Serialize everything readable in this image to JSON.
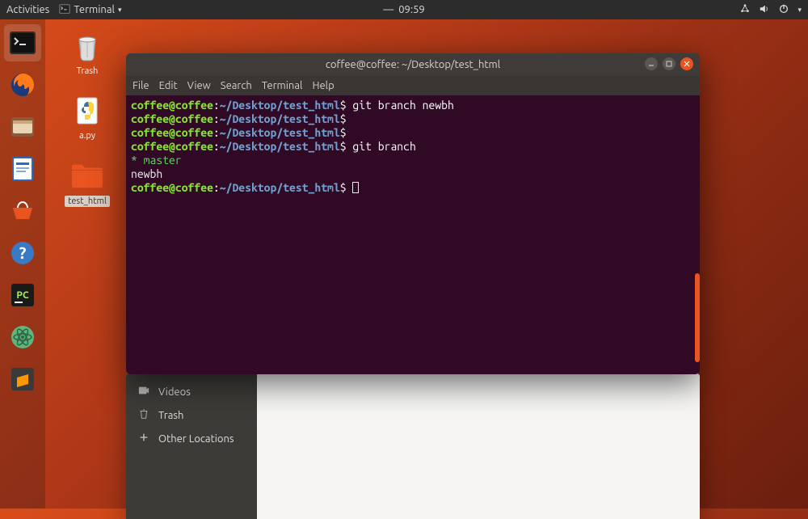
{
  "topbar": {
    "activities": "Activities",
    "app_label": "Terminal",
    "time": "09:59"
  },
  "desktop": {
    "icons": [
      {
        "label": "Trash"
      },
      {
        "label": "a.py"
      },
      {
        "label": "test_html"
      }
    ]
  },
  "files": {
    "items": [
      {
        "icon": "video-icon",
        "label": "Videos"
      },
      {
        "icon": "trash-icon",
        "label": "Trash"
      },
      {
        "icon": "plus-icon",
        "label": "Other Locations"
      }
    ]
  },
  "terminal": {
    "title": "coffee@coffee: ~/Desktop/test_html",
    "menu": [
      "File",
      "Edit",
      "View",
      "Search",
      "Terminal",
      "Help"
    ],
    "prompt": {
      "user": "coffee@coffee",
      "sep": ":",
      "path": "~/Desktop/test_html",
      "sym": "$"
    },
    "lines": [
      {
        "type": "prompt",
        "cmd": "git branch newbh"
      },
      {
        "type": "prompt",
        "cmd": ""
      },
      {
        "type": "prompt",
        "cmd": ""
      },
      {
        "type": "prompt",
        "cmd": "git branch"
      },
      {
        "type": "out-cur",
        "text": "* master"
      },
      {
        "type": "out",
        "text": "  newbh"
      },
      {
        "type": "prompt-cursor",
        "cmd": ""
      }
    ]
  }
}
